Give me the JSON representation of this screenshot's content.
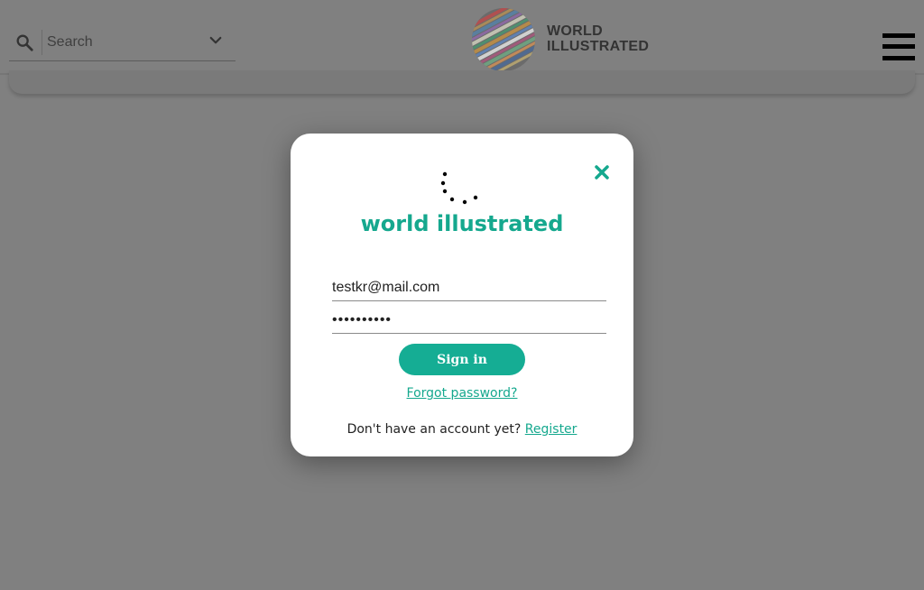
{
  "header": {
    "search_placeholder": "Search",
    "brand_line1": "WORLD",
    "brand_line2": "ILLUSTRATED"
  },
  "icons": {
    "search": "search-icon",
    "dropdown": "chevron-down-icon",
    "menu": "hamburger-menu-icon",
    "close": "close-icon",
    "loading": "loading-spinner-icon"
  },
  "modal": {
    "title": "world illustrated",
    "email_value": "testkr@mail.com",
    "password_value": "••••••••••",
    "signin_label": "Sign in",
    "forgot_label": "Forgot password?",
    "register_prompt": "Don't have an account yet?",
    "register_label": "Register"
  },
  "colors": {
    "accent": "#15a88e",
    "overlay": "#808080",
    "modal_bg": "#ffffff"
  }
}
